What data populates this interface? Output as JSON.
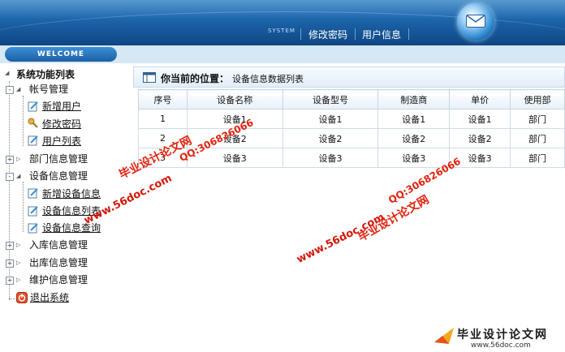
{
  "header": {
    "system_label": "SYSTEM",
    "nav": [
      "修改密码",
      "用户信息"
    ]
  },
  "welcome": "WELCOME",
  "sidebar": {
    "title": "系统功能列表",
    "groups": [
      {
        "label": "帐号管理",
        "children": [
          "新增用户",
          "修改密码",
          "用户列表"
        ]
      },
      {
        "label": "部门信息管理"
      },
      {
        "label": "设备信息管理",
        "children": [
          "新增设备信息",
          "设备信息列表",
          "设备信息查询"
        ]
      },
      {
        "label": "入库信息管理"
      },
      {
        "label": "出库信息管理"
      },
      {
        "label": "维护信息管理"
      }
    ],
    "logout": "退出系统"
  },
  "breadcrumb": {
    "label": "你当前的位置：",
    "value": "设备信息数据列表"
  },
  "table": {
    "columns": [
      "序号",
      "设备名称",
      "设备型号",
      "制造商",
      "单价",
      "使用部"
    ],
    "rows": [
      [
        "1",
        "设备1",
        "设备1",
        "设备1",
        "设备1",
        "部门"
      ],
      [
        "2",
        "设备2",
        "设备2",
        "设备2",
        "设备2",
        "部门"
      ],
      [
        "3",
        "设备3",
        "设备3",
        "设备3",
        "设备3",
        "部门"
      ]
    ]
  },
  "watermarks": {
    "site_cn": "毕业设计论文网",
    "qq": "QQ:306826066",
    "url": "www.56doc.com"
  },
  "footer_logo": {
    "title": "毕业设计论文网",
    "url": "www.56doc.com"
  },
  "colors": {
    "header_blue": "#1c63a8",
    "watermark_red": "#e0230f",
    "table_border": "#cfdce8"
  }
}
